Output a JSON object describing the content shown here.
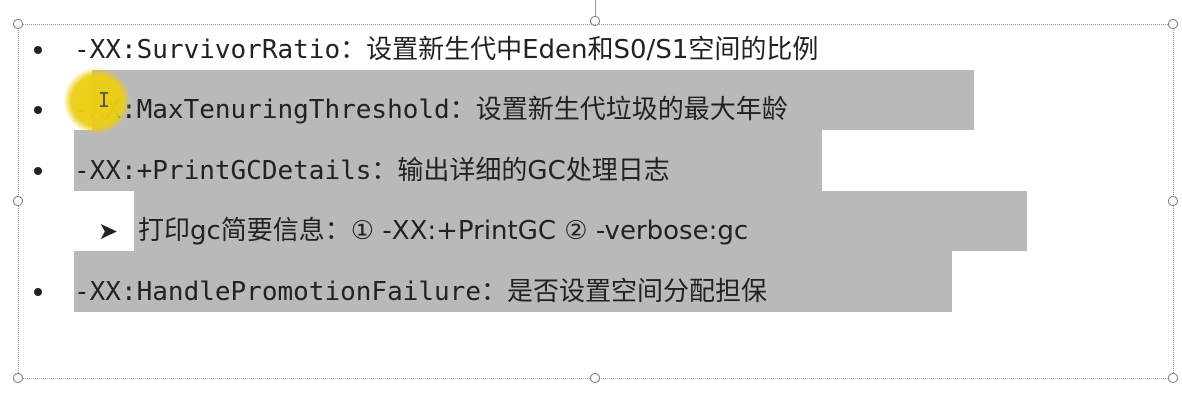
{
  "slide": {
    "items": [
      {
        "code": "-XX:SurvivorRatio",
        "desc": "：设置新生代中Eden和S0/S1空间的比例"
      },
      {
        "code": "-XX:MaxTenuringThreshold",
        "desc": "：设置新生代垃圾的最大年龄"
      },
      {
        "code": "-XX:+PrintGCDetails",
        "desc": "：输出详细的GC处理日志"
      },
      {
        "sub": "打印gc简要信息：① -XX:+PrintGC   ② -verbose:gc"
      },
      {
        "code": "-XX:HandlePromotionFailure",
        "desc": "：是否设置空间分配担保"
      }
    ]
  },
  "colors": {
    "selection": "#b9b9b9",
    "cursor": "#ecce14",
    "text": "#222222"
  }
}
